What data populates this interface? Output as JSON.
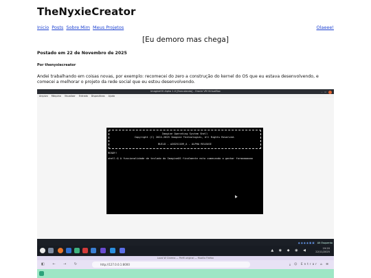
{
  "site": {
    "title": "TheNyxieCreator",
    "nav": [
      "Inicio",
      "Posts",
      "Sobre Mim",
      "Meus Projetos"
    ],
    "nav_right": "Olaeee!"
  },
  "post": {
    "title": "[Eu demoro mas chega]",
    "date": "Postado em 22 de Novembro de 2025",
    "author": "Por thenyxiecreator",
    "body": "Andei trabalhando em coisas novas, por exemplo: recomecei do zero a construção do kernel do OS que eu estava desenvolvendo, e comecei a melhorar o projeto da rede social que eu estou desenvolvendo."
  },
  "screenshot": {
    "window_title": "ImagineOS Alpha 1.0 [Executando] - Oracle VM VirtualBox",
    "menu": [
      "Arquivo",
      "Máquina",
      "Visualizar",
      "Entrada",
      "Dispositivos",
      "Ajuda"
    ],
    "console": {
      "banner_line1": "Imagine Operating System Shell",
      "banner_line2": "Copyright (C) 2024-2025 Imagine Technologies, All Rights Reserved.",
      "build": "BUILD - a20251109_A - ALPHA RELEASE",
      "ready": "READY!",
      "prompt": "shell:$ A funcionalidade de teclado do ImagineOS finalmente esta comecando a ganhar formaaaaaaa"
    },
    "status_right": "Alt Esquerdo",
    "tray_time": "19:20",
    "tray_date": "22/11/2025",
    "browser_title": "Local W Cinema — Perfil original — Mozilla Firefox",
    "url": "http://127.0.0.1:8000",
    "browser_right": "Entrar"
  }
}
